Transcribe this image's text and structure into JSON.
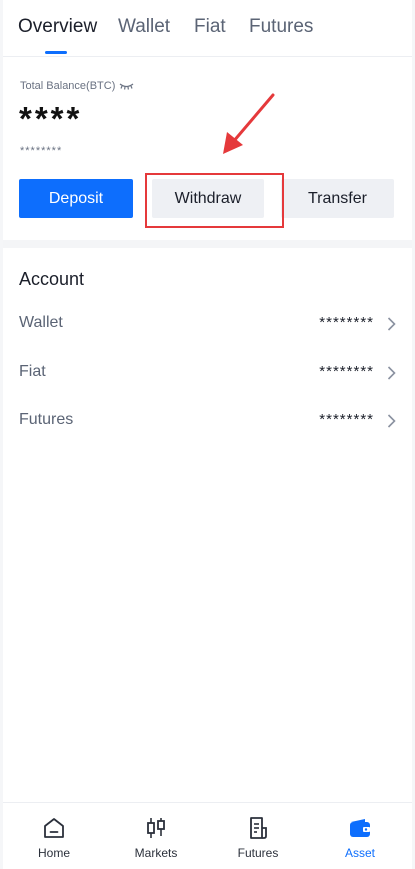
{
  "tabs": [
    {
      "label": "Overview",
      "active": true
    },
    {
      "label": "Wallet",
      "active": false
    },
    {
      "label": "Fiat",
      "active": false
    },
    {
      "label": "Futures",
      "active": false
    }
  ],
  "balance": {
    "label": "Total Balance(BTC)",
    "value": "****",
    "sub_value": "********"
  },
  "actions": {
    "deposit": "Deposit",
    "withdraw": "Withdraw",
    "transfer": "Transfer"
  },
  "account": {
    "title": "Account",
    "rows": [
      {
        "name": "Wallet",
        "value": "********"
      },
      {
        "name": "Fiat",
        "value": "********"
      },
      {
        "name": "Futures",
        "value": "********"
      }
    ]
  },
  "bottom_nav": [
    {
      "label": "Home",
      "icon": "home-icon",
      "active": false
    },
    {
      "label": "Markets",
      "icon": "candlestick-icon",
      "active": false
    },
    {
      "label": "Futures",
      "icon": "document-icon",
      "active": false
    },
    {
      "label": "Asset",
      "icon": "wallet-icon",
      "active": true
    }
  ],
  "colors": {
    "accent": "#0d6efd",
    "annotation": "#e5393b"
  }
}
